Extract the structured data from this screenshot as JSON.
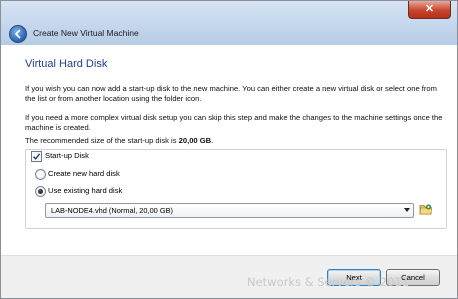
{
  "window": {
    "title": "Create New Virtual Machine",
    "close_symbol": "✕"
  },
  "page": {
    "heading": "Virtual Hard Disk",
    "para1": "If you wish you can now add a start-up disk to the new machine. You can either create a new virtual disk or select one from the list or from another location using the folder icon.",
    "para2": "If you need a more complex virtual disk setup you can skip this step and make the changes to the machine settings once the machine is created.",
    "para3_prefix": "The recommended size of the start-up disk is ",
    "para3_size": "20,00 GB",
    "para3_suffix": "."
  },
  "startup_disk": {
    "checkbox_label": "Start-up Disk",
    "checked": true,
    "option_create": "Create new hard disk",
    "option_existing": "Use existing hard disk",
    "selected_option": "existing",
    "selected_disk": "LAB-NODE4.vhd (Normal, 20,00 GB)"
  },
  "footer": {
    "next_label": "Next",
    "cancel_label": "Cancel"
  },
  "watermark": "Networks & Servers © 2011",
  "icons": {
    "back": "back-arrow-icon",
    "folder": "folder-icon",
    "check": "checkmark-icon"
  }
}
